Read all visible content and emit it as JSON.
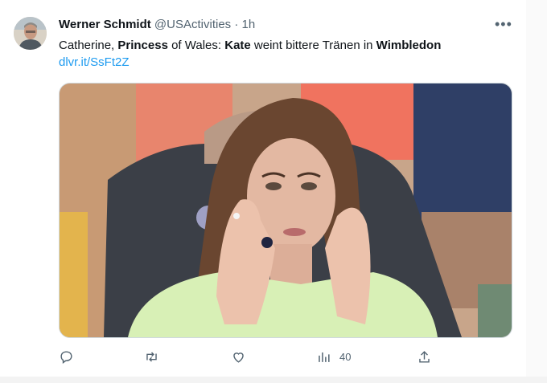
{
  "tweet": {
    "author_name": "Werner Schmidt",
    "author_handle": "@USActivities",
    "separator": "·",
    "time": "1h",
    "text_parts": [
      {
        "text": "Catherine, ",
        "bold": false
      },
      {
        "text": "Princess",
        "bold": true
      },
      {
        "text": " of Wales: ",
        "bold": false
      },
      {
        "text": "Kate",
        "bold": true
      },
      {
        "text": " weint bittere Tränen in ",
        "bold": false
      },
      {
        "text": "Wimbledon",
        "bold": true
      }
    ],
    "link": "dlvr.it/SsFt2Z",
    "more_icon": "more-icon",
    "media_description_icon": "photo"
  },
  "actions": {
    "reply_icon": "reply-icon",
    "retweet_icon": "retweet-icon",
    "like_icon": "like-icon",
    "views_icon": "views-icon",
    "views_count": "40",
    "share_icon": "share-icon"
  },
  "colors": {
    "accent": "#1d9bf0",
    "muted": "#536471",
    "text": "#0f1419"
  }
}
